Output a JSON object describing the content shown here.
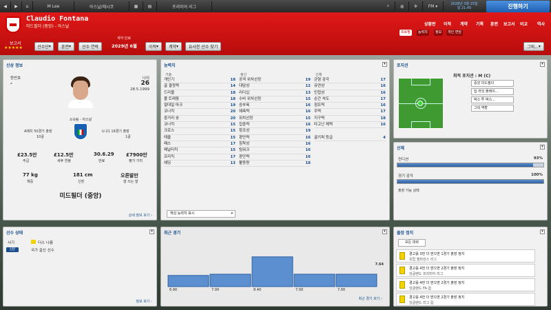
{
  "topbar": {
    "manager": "M Lee",
    "club": "아스날/헤시코",
    "league": "프리미어 리그",
    "date": "2028년 3월 25일",
    "time": "일 21:45",
    "proceed": "진행하기"
  },
  "header": {
    "player_name": "Claudio Fontana",
    "subtitle": "미드필더 (중앙) - 아스날",
    "report_label": "보고서",
    "stars": "★★★★★",
    "contract_label": "계약 만료",
    "contract_date": "2029년 6월"
  },
  "header_buttons": {
    "squad": "선수단",
    "training": "훈련",
    "player_info": "선수 연락",
    "transfer": "이적",
    "contract": "계약",
    "similar": "유사한 선수 찾기",
    "more": "그외..."
  },
  "nav": {
    "items": [
      "상황판",
      "이적",
      "계약",
      "기록",
      "훈련",
      "보고서",
      "비교",
      "역사"
    ],
    "tabs": [
      "프로필",
      "능력치",
      "정보",
      "개인 면담"
    ]
  },
  "info_panel": {
    "title": "신상 정보",
    "uniform_label": "등번호",
    "uniform": "-",
    "age_label": "나이",
    "age": "26",
    "dob": "28.5.1999",
    "club_name": "소속팀 - 아스날",
    "caps_label": "A매치 50경기 출장",
    "caps_goals": "10골",
    "u21_label": "U-21 16경기 출장",
    "u21_goals": "1골",
    "value1": "£23.5만",
    "value1_label": "주급",
    "value2": "£12.5만",
    "value2_label": "세후 연봉",
    "value3": "30.6.29",
    "value3_label": "만료",
    "value4": "£7900만",
    "value4_label": "평가 가치",
    "weight": "77 kg",
    "weight_label": "체중",
    "height": "181 cm",
    "height_label": "신장",
    "foot": "오른발만",
    "foot_label": "잘 쓰는 발",
    "position": "미드필더 (중앙)",
    "more": "상세 정보 보기"
  },
  "attr_panel": {
    "title": "능력치",
    "headers": [
      "기술",
      "정신",
      "신체"
    ],
    "technical": [
      [
        "개인기",
        "18"
      ],
      [
        "골 결정력",
        "14"
      ],
      [
        "드리블",
        "18"
      ],
      [
        "볼 트래핑",
        "18"
      ],
      [
        "얼대일 마크",
        "19"
      ],
      [
        "코너킥",
        "20"
      ],
      [
        "중거리 슛",
        "20"
      ],
      [
        "코너킥",
        "15"
      ],
      [
        "크로스",
        "15"
      ],
      [
        "태클",
        "15"
      ],
      [
        "패스",
        "17"
      ],
      [
        "페널티킥",
        "15"
      ],
      [
        "프리킥",
        "17"
      ],
      [
        "헤딩",
        "13"
      ]
    ],
    "mental": [
      [
        "공격 위치선정",
        "19"
      ],
      [
        "대담성",
        "12"
      ],
      [
        "리더십",
        "13"
      ],
      [
        "수비 위치선정",
        "15"
      ],
      [
        "승부욕",
        "16"
      ],
      [
        "예측력",
        "16"
      ],
      [
        "위치선정",
        "15"
      ],
      [
        "집중력",
        "16"
      ],
      [
        "창조성",
        "19"
      ],
      [
        "판단력",
        "16"
      ],
      [
        "침착성",
        "16"
      ],
      [
        "팀워크",
        "16"
      ],
      [
        "판단력",
        "16"
      ],
      [
        "활동량",
        "18"
      ]
    ],
    "physical": [
      [
        "균형 감각",
        "17"
      ],
      [
        "유연성",
        "16"
      ],
      [
        "민첩성",
        "16"
      ],
      [
        "순간 속도",
        "17"
      ],
      [
        "점프력",
        "16"
      ],
      [
        "주력",
        "17"
      ],
      [
        "지구력",
        "18"
      ],
      [
        "타고난 체력",
        "16"
      ],
      [
        "",
        ""
      ],
      [
        "골키퍼 등급",
        "4"
      ]
    ],
    "key_select": "핵심 능력치 표시"
  },
  "position_panel": {
    "title": "포지션",
    "best_label": "최적 포지션 : M (C)",
    "roles": [
      "중앙 미드필더",
      "딥 라잉 플레이...",
      "박스 투 박스...",
      "그외 역할"
    ]
  },
  "body_panel": {
    "title": "신체",
    "condition_label": "컨디션",
    "condition": "93%",
    "condition_pct": 93,
    "fitness_label": "경기 감각",
    "fitness": "100%",
    "fitness_pct": 100,
    "status": "출장 가능 상태"
  },
  "status_panel": {
    "title": "선수 상태",
    "row1_label": "서기",
    "row1_value": "더스 나름",
    "row2_badge": "신분",
    "row2_value": "국가 출신 선수",
    "more": "정보 보기"
  },
  "recent_panel": {
    "title": "최근 경기",
    "last_value": "7.64",
    "more": "최근 경기 보기"
  },
  "chart_data": {
    "type": "bar",
    "categories": [
      "1",
      "2",
      "3",
      "4",
      "5"
    ],
    "values": [
      6.9,
      7.0,
      8.4,
      7.0,
      7.0
    ],
    "ylim": [
      6,
      9
    ],
    "labels": [
      "6.90",
      "7.00",
      "8.40",
      "7.00",
      "7.00"
    ]
  },
  "suspension_panel": {
    "title": "출장 정지",
    "filter": "모든 대회",
    "items": [
      [
        "경고를 3번 더 받으면 1경기 출장 정지",
        "유럽 챔피언스 리그"
      ],
      [
        "경고를 4번 더 받으면 2경기 출장 정지",
        "잉글랜드 프리미어 리그"
      ],
      [
        "경고를 4번 더 받으면 2경기 출장 정지",
        "잉글랜드 FA 컵"
      ],
      [
        "경고를 4번 더 받으면 2경기 출장 정지",
        "잉글랜드 리그 컵"
      ]
    ]
  },
  "colors": {
    "header_red": "#d51414",
    "accent_blue": "#2d5fa3",
    "proceed": "#2a6cc4"
  }
}
